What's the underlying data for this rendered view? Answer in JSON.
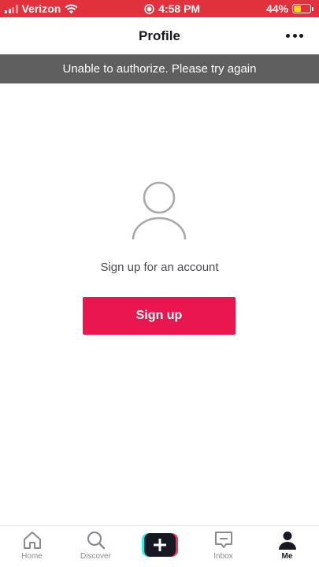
{
  "status_bar": {
    "carrier": "Verizon",
    "time": "4:58 PM",
    "battery_percent": "44%",
    "battery_level": 0.44,
    "signal_bars": 2,
    "colors": {
      "background": "#e0313c",
      "battery_fill": "#ffd60a"
    }
  },
  "header": {
    "title": "Profile",
    "more_icon": "ellipsis-icon"
  },
  "banner": {
    "message": "Unable to authorize. Please try again"
  },
  "empty_state": {
    "icon": "user-outline-icon",
    "prompt": "Sign up for an account",
    "button_label": "Sign up",
    "colors": {
      "button": "#ea1650"
    }
  },
  "bottom_nav": {
    "items": [
      {
        "label": "Home",
        "icon": "home-icon"
      },
      {
        "label": "Discover",
        "icon": "search-icon"
      },
      {
        "label": "",
        "icon": "plus-icon"
      },
      {
        "label": "Inbox",
        "icon": "inbox-icon"
      },
      {
        "label": "Me",
        "icon": "person-icon",
        "active": true
      }
    ]
  }
}
